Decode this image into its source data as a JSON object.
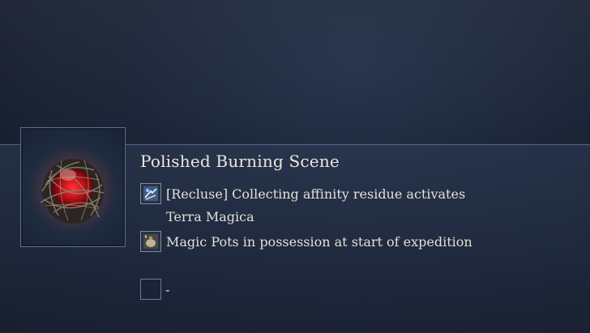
{
  "relic": {
    "title": "Polished Burning Scene",
    "icon": "burning-scene-relic-icon"
  },
  "effects": [
    {
      "icon": "recluse-affinity-icon",
      "line1": "[Recluse] Collecting affinity residue activates",
      "line2": "Terra Magica"
    },
    {
      "icon": "magic-pot-icon",
      "line1": "Magic Pots in possession at start of expedition"
    }
  ],
  "empty_slot": {
    "label": "-"
  }
}
